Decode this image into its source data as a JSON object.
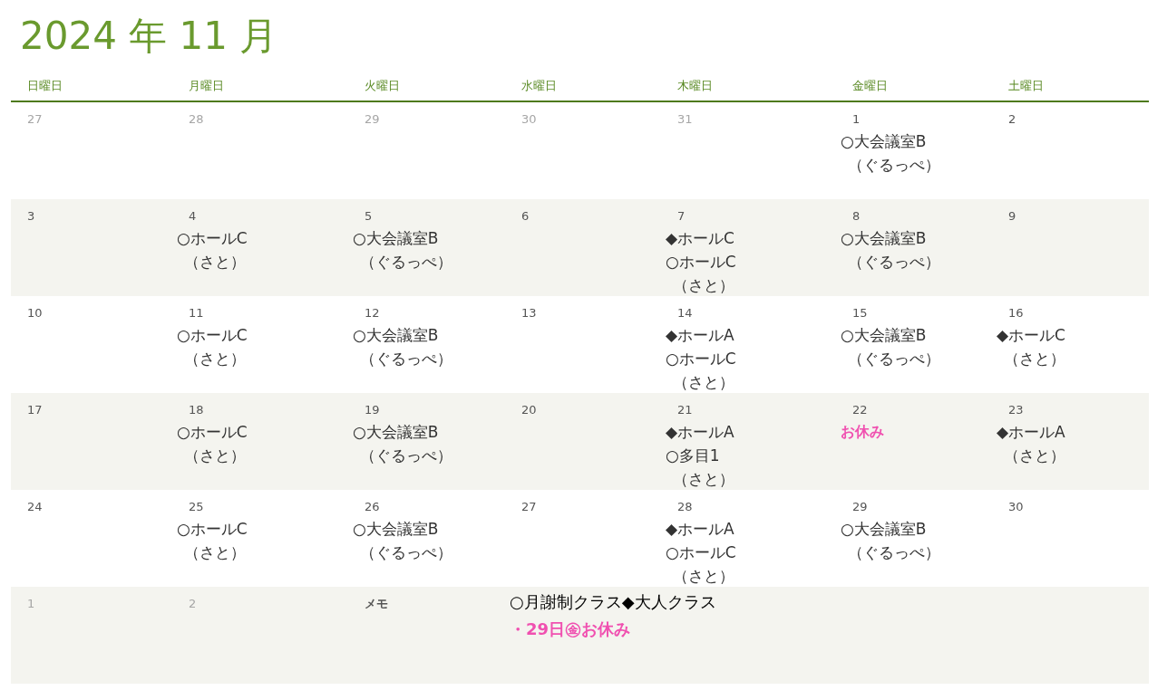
{
  "title": "2024 年 11 月",
  "weekdays": [
    "日曜日",
    "月曜日",
    "火曜日",
    "水曜日",
    "木曜日",
    "金曜日",
    "土曜日"
  ],
  "weeks": [
    {
      "days": [
        {
          "day": "27",
          "in_month": false
        },
        {
          "day": "28",
          "in_month": false
        },
        {
          "day": "29",
          "in_month": false
        },
        {
          "day": "30",
          "in_month": false
        },
        {
          "day": "31",
          "in_month": false
        },
        {
          "day": "1",
          "in_month": true,
          "events": [
            {
              "kind": "place",
              "text": "○大会議室B"
            },
            {
              "kind": "person",
              "text": "（ぐるっぺ）"
            }
          ]
        },
        {
          "day": "2",
          "in_month": true
        }
      ]
    },
    {
      "days": [
        {
          "day": "3",
          "in_month": true
        },
        {
          "day": "4",
          "in_month": true,
          "events": [
            {
              "kind": "place",
              "text": "○ホールC"
            },
            {
              "kind": "person",
              "text": "（さと）"
            }
          ]
        },
        {
          "day": "5",
          "in_month": true,
          "events": [
            {
              "kind": "place",
              "text": "○大会議室B"
            },
            {
              "kind": "person",
              "text": "（ぐるっぺ）"
            }
          ]
        },
        {
          "day": "6",
          "in_month": true
        },
        {
          "day": "7",
          "in_month": true,
          "events": [
            {
              "kind": "place",
              "text": "◆ホールC"
            },
            {
              "kind": "place",
              "text": "○ホールC"
            },
            {
              "kind": "person",
              "text": "（さと）"
            }
          ]
        },
        {
          "day": "8",
          "in_month": true,
          "events": [
            {
              "kind": "place",
              "text": "○大会議室B"
            },
            {
              "kind": "person",
              "text": "（ぐるっぺ）"
            }
          ]
        },
        {
          "day": "9",
          "in_month": true
        }
      ]
    },
    {
      "days": [
        {
          "day": "10",
          "in_month": true
        },
        {
          "day": "11",
          "in_month": true,
          "events": [
            {
              "kind": "place",
              "text": "○ホールC"
            },
            {
              "kind": "person",
              "text": "（さと）"
            }
          ]
        },
        {
          "day": "12",
          "in_month": true,
          "events": [
            {
              "kind": "place",
              "text": "○大会議室B"
            },
            {
              "kind": "person",
              "text": "（ぐるっぺ）"
            }
          ]
        },
        {
          "day": "13",
          "in_month": true
        },
        {
          "day": "14",
          "in_month": true,
          "events": [
            {
              "kind": "place",
              "text": "◆ホールA"
            },
            {
              "kind": "place",
              "text": "○ホールC"
            },
            {
              "kind": "person",
              "text": "（さと）"
            }
          ]
        },
        {
          "day": "15",
          "in_month": true,
          "events": [
            {
              "kind": "place",
              "text": "○大会議室B"
            },
            {
              "kind": "person",
              "text": "（ぐるっぺ）"
            }
          ]
        },
        {
          "day": "16",
          "in_month": true,
          "events": [
            {
              "kind": "place",
              "text": "◆ホールC"
            },
            {
              "kind": "person",
              "text": "（さと）"
            }
          ]
        }
      ]
    },
    {
      "days": [
        {
          "day": "17",
          "in_month": true
        },
        {
          "day": "18",
          "in_month": true,
          "events": [
            {
              "kind": "place",
              "text": "○ホールC"
            },
            {
              "kind": "person",
              "text": "（さと）"
            }
          ]
        },
        {
          "day": "19",
          "in_month": true,
          "events": [
            {
              "kind": "place",
              "text": "○大会議室B"
            },
            {
              "kind": "person",
              "text": "（ぐるっぺ）"
            }
          ]
        },
        {
          "day": "20",
          "in_month": true
        },
        {
          "day": "21",
          "in_month": true,
          "events": [
            {
              "kind": "place",
              "text": "◆ホールA"
            },
            {
              "kind": "place",
              "text": "○多目1"
            },
            {
              "kind": "person",
              "text": "（さと）"
            }
          ]
        },
        {
          "day": "22",
          "in_month": true,
          "events": [
            {
              "kind": "holiday",
              "text": "お休み"
            }
          ]
        },
        {
          "day": "23",
          "in_month": true,
          "events": [
            {
              "kind": "place",
              "text": "◆ホールA"
            },
            {
              "kind": "person",
              "text": "（さと）"
            }
          ]
        }
      ]
    },
    {
      "days": [
        {
          "day": "24",
          "in_month": true
        },
        {
          "day": "25",
          "in_month": true,
          "events": [
            {
              "kind": "place",
              "text": "○ホールC"
            },
            {
              "kind": "person",
              "text": "（さと）"
            }
          ]
        },
        {
          "day": "26",
          "in_month": true,
          "events": [
            {
              "kind": "place",
              "text": "○大会議室B"
            },
            {
              "kind": "person",
              "text": "（ぐるっぺ）"
            }
          ]
        },
        {
          "day": "27",
          "in_month": true
        },
        {
          "day": "28",
          "in_month": true,
          "events": [
            {
              "kind": "place",
              "text": "◆ホールA"
            },
            {
              "kind": "place",
              "text": "○ホールC"
            },
            {
              "kind": "person",
              "text": "（さと）"
            }
          ]
        },
        {
          "day": "29",
          "in_month": true,
          "events": [
            {
              "kind": "place",
              "text": "○大会議室B"
            },
            {
              "kind": "person",
              "text": "（ぐるっぺ）"
            }
          ]
        },
        {
          "day": "30",
          "in_month": true
        }
      ]
    }
  ],
  "last_row": {
    "days": [
      {
        "day": "1",
        "in_month": false
      },
      {
        "day": "2",
        "in_month": false
      }
    ],
    "memo": {
      "label": "メモ",
      "lines": [
        {
          "kind": "note",
          "text": "○月謝制クラス◆大人クラス"
        },
        {
          "kind": "holiday",
          "text": "・29日㊎お休み"
        }
      ]
    }
  }
}
